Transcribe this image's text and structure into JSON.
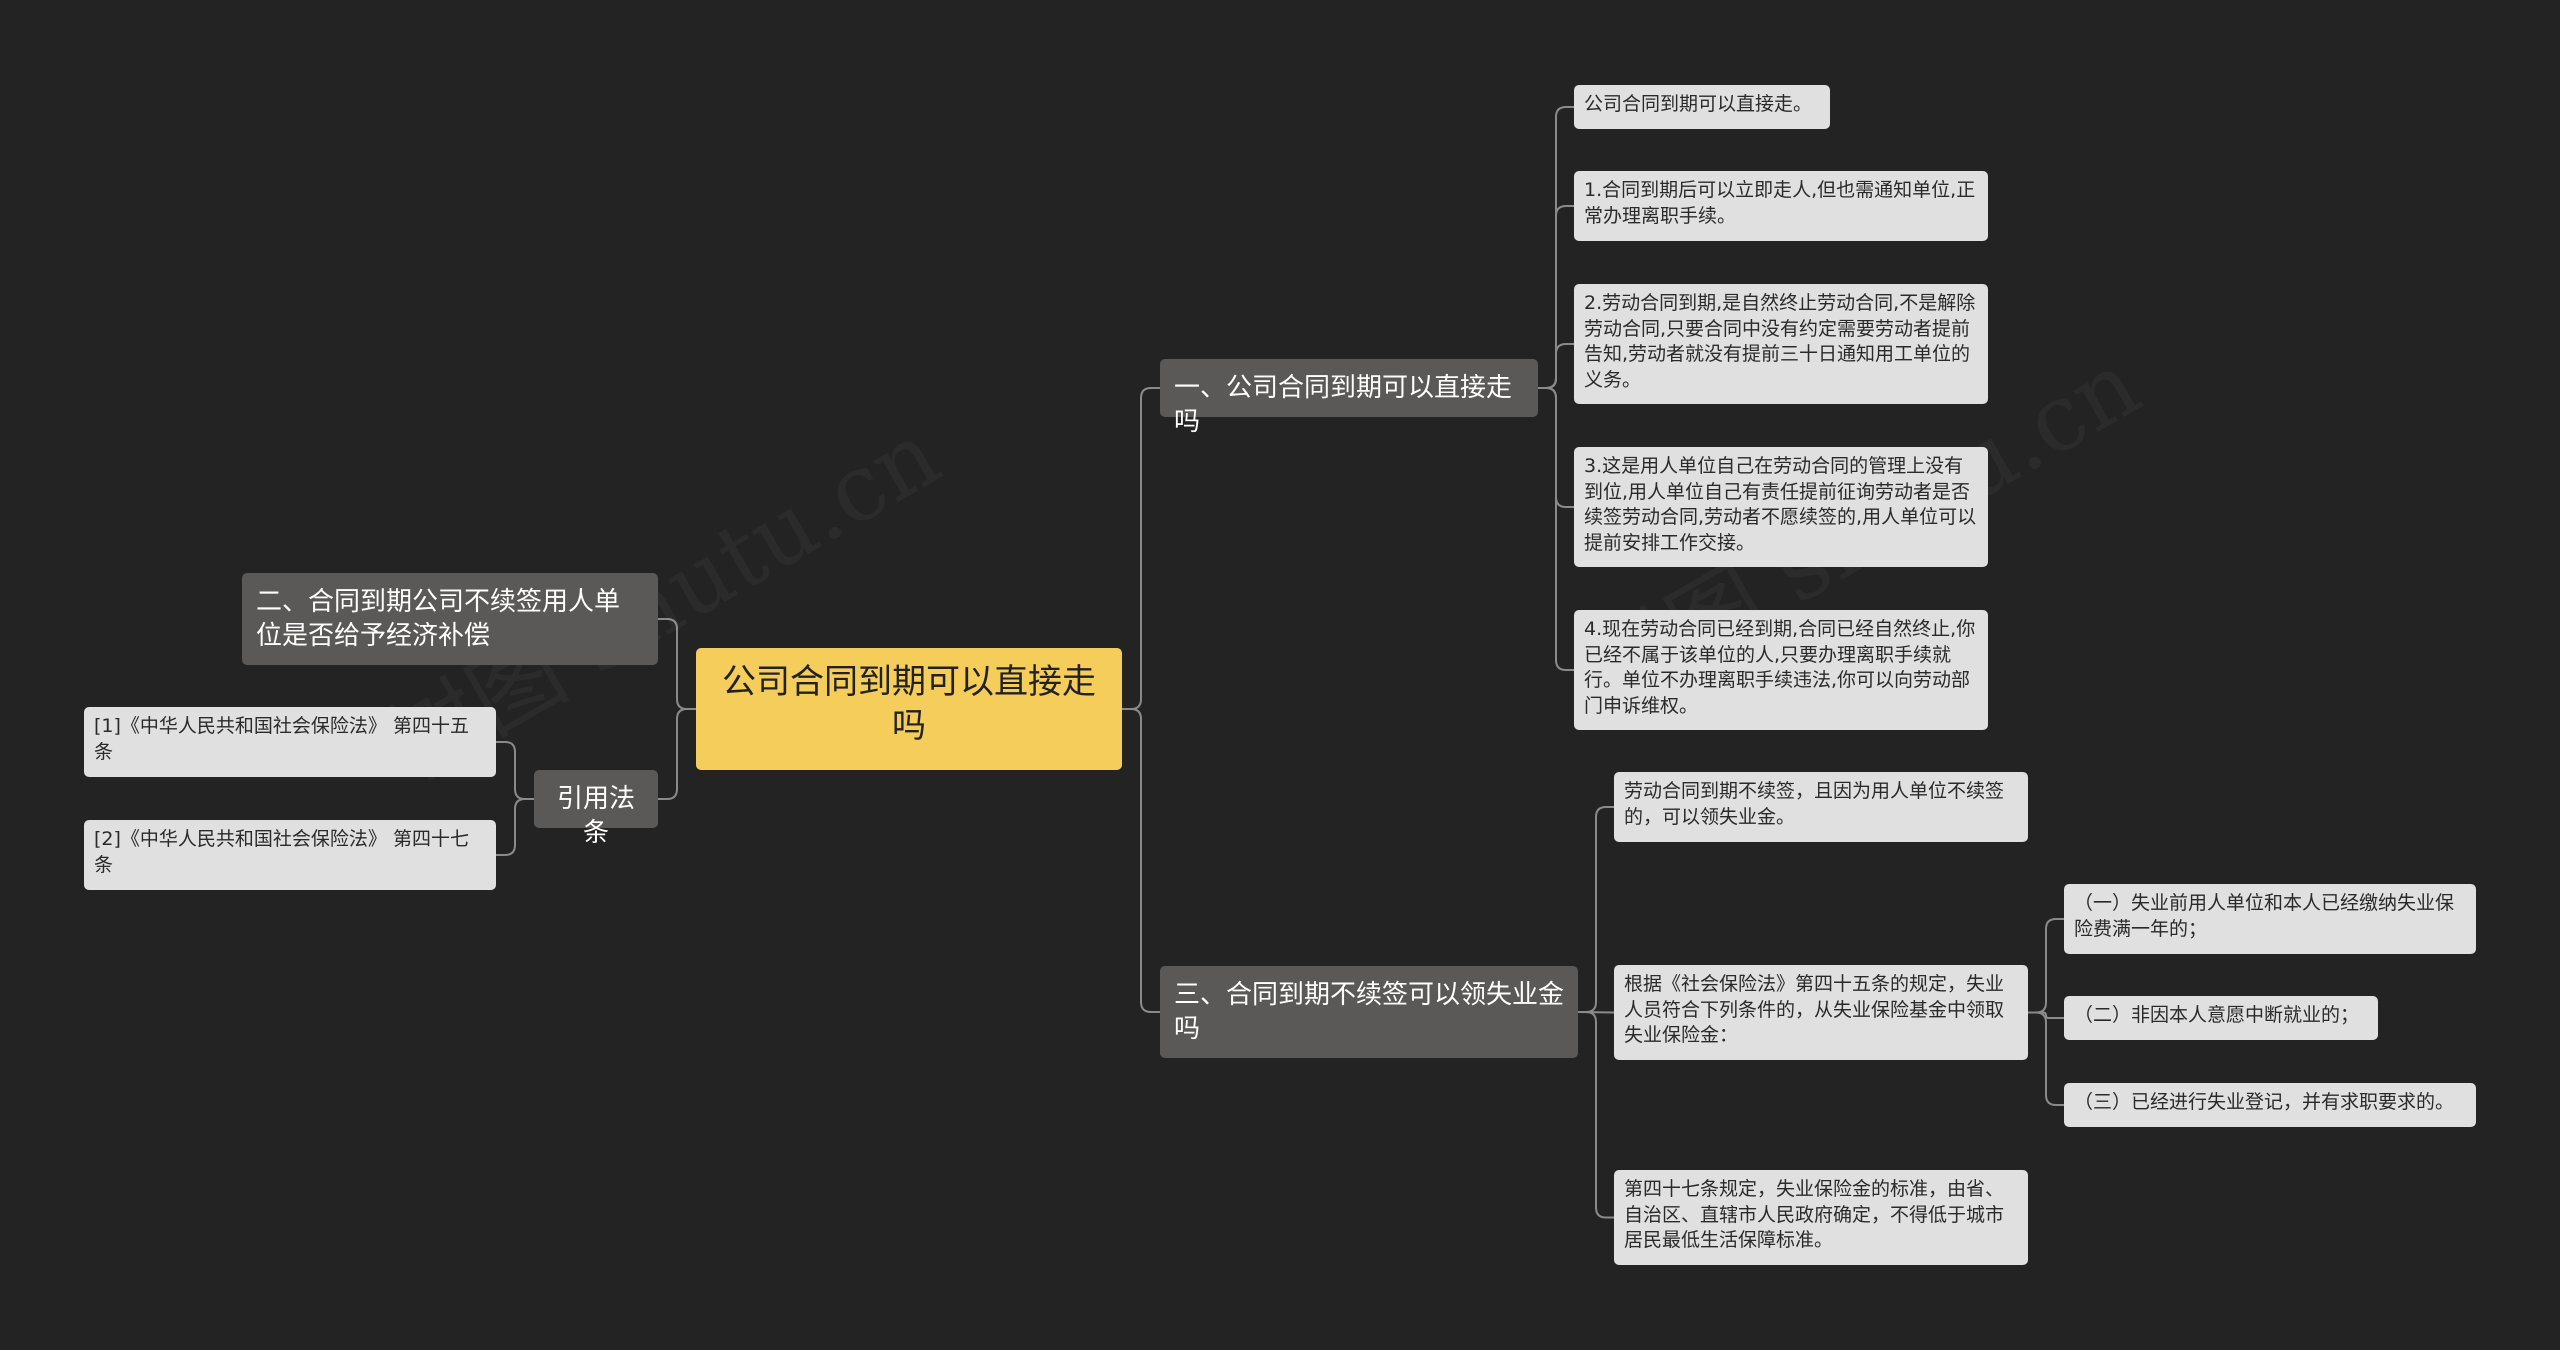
{
  "root": {
    "label": "公司合同到期可以直接走吗"
  },
  "left": {
    "branch2": {
      "label": "二、合同到期公司不续签用人单位是否给予经济补偿"
    },
    "citations": {
      "label": "引用法条",
      "items": [
        "[1]《中华人民共和国社会保险法》 第四十五条",
        "[2]《中华人民共和国社会保险法》 第四十七条"
      ]
    }
  },
  "right": {
    "branch1": {
      "label": "一、公司合同到期可以直接走吗",
      "leaves": [
        "公司合同到期可以直接走。",
        "1.合同到期后可以立即走人,但也需通知单位,正常办理离职手续。",
        "2.劳动合同到期,是自然终止劳动合同,不是解除劳动合同,只要合同中没有约定需要劳动者提前告知,劳动者就没有提前三十日通知用工单位的义务。",
        "3.这是用人单位自己在劳动合同的管理上没有到位,用人单位自己有责任提前征询劳动者是否续签劳动合同,劳动者不愿续签的,用人单位可以提前安排工作交接。",
        "4.现在劳动合同已经到期,合同已经自然终止,你已经不属于该单位的人,只要办理离职手续就行。单位不办理离职手续违法,你可以向劳动部门申诉维权。"
      ]
    },
    "branch3": {
      "label": "三、合同到期不续签可以领失业金吗",
      "leaves": [
        "劳动合同到期不续签，且因为用人单位不续签的，可以领失业金。",
        "根据《社会保险法》第四十五条的规定，失业人员符合下列条件的，从失业保险基金中领取失业保险金：",
        "第四十七条规定，失业保险金的标准，由省、自治区、直辖市人民政府确定，不得低于城市居民最低生活保障标准。"
      ],
      "conditions": [
        "（一）失业前用人单位和本人已经缴纳失业保险费满一年的；",
        "（二）非因本人意愿中断就业的；",
        "（三）已经进行失业登记，并有求职要求的。"
      ]
    }
  },
  "watermarks": [
    "树图 shutu.cn",
    "树图 shutu.cn"
  ],
  "colors": {
    "background": "#232323",
    "root": "#f5cd5b",
    "branch": "#5b5958",
    "leaf": "#e0e0e0",
    "connector": "#8a8a8a"
  }
}
